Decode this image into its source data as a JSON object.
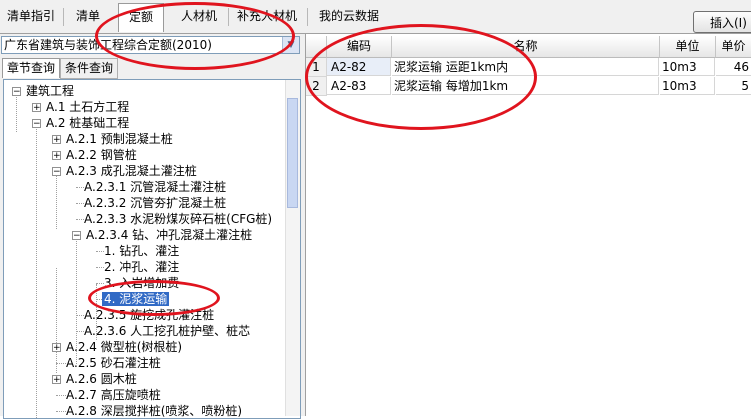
{
  "tabs": [
    "清单指引",
    "清单",
    "定额",
    "人材机",
    "补充人材机",
    "我的云数据"
  ],
  "insert_button": "插入(I)",
  "quota_library": "广东省建筑与装饰工程综合定额(2010)",
  "subtabs": [
    "章节查询",
    "条件查询"
  ],
  "tree": [
    {
      "label": "建筑工程",
      "expander": "−"
    },
    {
      "label": "A.1 土石方工程",
      "expander": "+"
    },
    {
      "label": "A.2 桩基础工程",
      "expander": "−"
    },
    {
      "label": "A.2.1 预制混凝土桩",
      "expander": "+"
    },
    {
      "label": "A.2.2 钢管桩",
      "expander": "+"
    },
    {
      "label": "A.2.3 成孔混凝土灌注桩",
      "expander": "−"
    },
    {
      "label": "A.2.3.1 沉管混凝土灌注桩",
      "expander": ""
    },
    {
      "label": "A.2.3.2 沉管夯扩混凝土桩",
      "expander": ""
    },
    {
      "label": "A.2.3.3 水泥粉煤灰碎石桩(CFG桩)",
      "expander": ""
    },
    {
      "label": "A.2.3.4 钻、冲孔混凝土灌注桩",
      "expander": "−"
    },
    {
      "label": "1. 钻孔、灌注",
      "expander": ""
    },
    {
      "label": "2. 冲孔、灌注",
      "expander": ""
    },
    {
      "label": "3. 入岩增加费",
      "expander": ""
    },
    {
      "label": "4. 泥浆运输",
      "expander": "",
      "selected": true
    },
    {
      "label": "A.2.3.5 旋挖成孔灌注桩",
      "expander": ""
    },
    {
      "label": "A.2.3.6 人工挖孔桩护壁、桩芯",
      "expander": ""
    },
    {
      "label": "A.2.4 微型桩(树根桩)",
      "expander": "+"
    },
    {
      "label": "A.2.5 砂石灌注桩",
      "expander": ""
    },
    {
      "label": "A.2.6 圆木桩",
      "expander": "+"
    },
    {
      "label": "A.2.7 高压旋喷桩",
      "expander": ""
    },
    {
      "label": "A.2.8 深层搅拌桩(喷浆、喷粉桩)",
      "expander": ""
    }
  ],
  "grid": {
    "headers": [
      "编码",
      "名称",
      "单位",
      "单价"
    ],
    "rows": [
      {
        "num": "1",
        "code": "A2-82",
        "name": "泥浆运输 运距1km内",
        "unit": "10m3",
        "price": "46"
      },
      {
        "num": "2",
        "code": "A2-83",
        "name": "泥浆运输 每增加1km",
        "unit": "10m3",
        "price": "5"
      }
    ]
  },
  "annotation_color": "#e0141e"
}
